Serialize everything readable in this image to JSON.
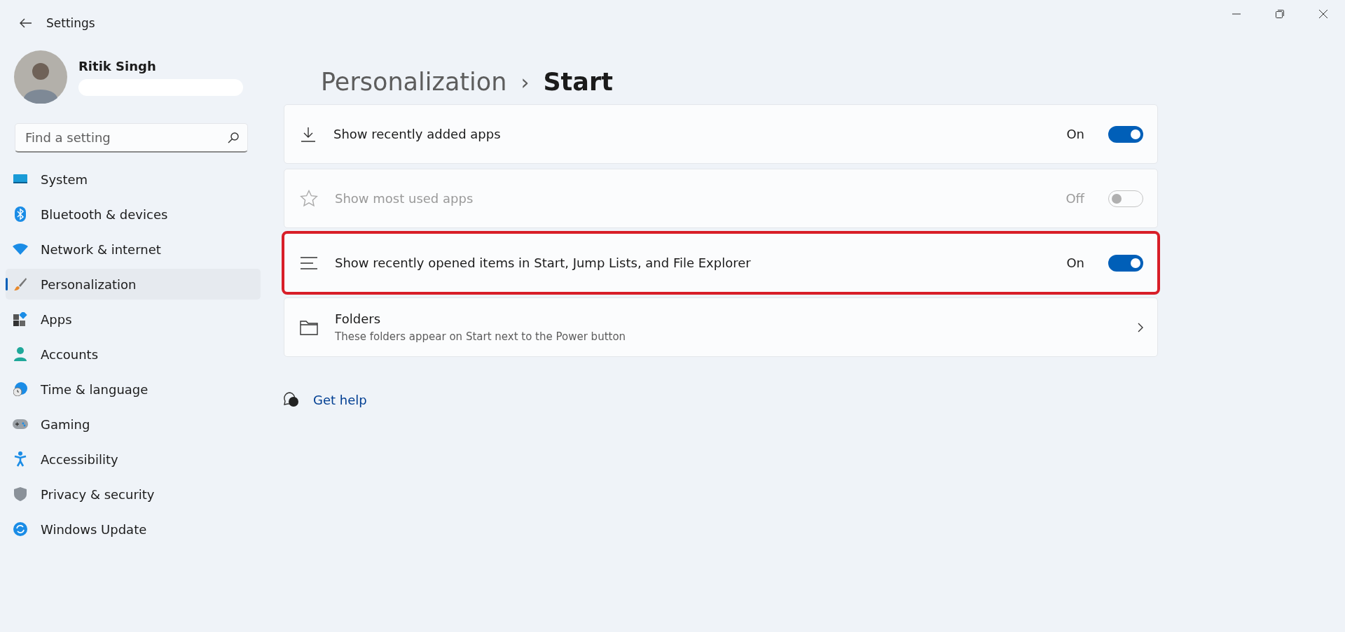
{
  "window": {
    "title": "Settings"
  },
  "user": {
    "name": "Ritik Singh"
  },
  "search": {
    "placeholder": "Find a setting"
  },
  "sidebar": {
    "items": [
      {
        "label": "System",
        "selected": false
      },
      {
        "label": "Bluetooth & devices",
        "selected": false
      },
      {
        "label": "Network & internet",
        "selected": false
      },
      {
        "label": "Personalization",
        "selected": true
      },
      {
        "label": "Apps",
        "selected": false
      },
      {
        "label": "Accounts",
        "selected": false
      },
      {
        "label": "Time & language",
        "selected": false
      },
      {
        "label": "Gaming",
        "selected": false
      },
      {
        "label": "Accessibility",
        "selected": false
      },
      {
        "label": "Privacy & security",
        "selected": false
      },
      {
        "label": "Windows Update",
        "selected": false
      }
    ]
  },
  "breadcrumb": {
    "parent": "Personalization",
    "separator": "›",
    "current": "Start"
  },
  "settings": [
    {
      "kind": "toggle",
      "label": "Show recently added apps",
      "state_label": "On",
      "on": true,
      "disabled": false,
      "highlighted": false
    },
    {
      "kind": "toggle",
      "label": "Show most used apps",
      "state_label": "Off",
      "on": false,
      "disabled": true,
      "highlighted": false
    },
    {
      "kind": "toggle",
      "label": "Show recently opened items in Start, Jump Lists, and File Explorer",
      "state_label": "On",
      "on": true,
      "disabled": false,
      "highlighted": true
    },
    {
      "kind": "link",
      "label": "Folders",
      "description": "These folders appear on Start next to the Power button",
      "highlighted": false
    }
  ],
  "help": {
    "label": "Get help"
  }
}
